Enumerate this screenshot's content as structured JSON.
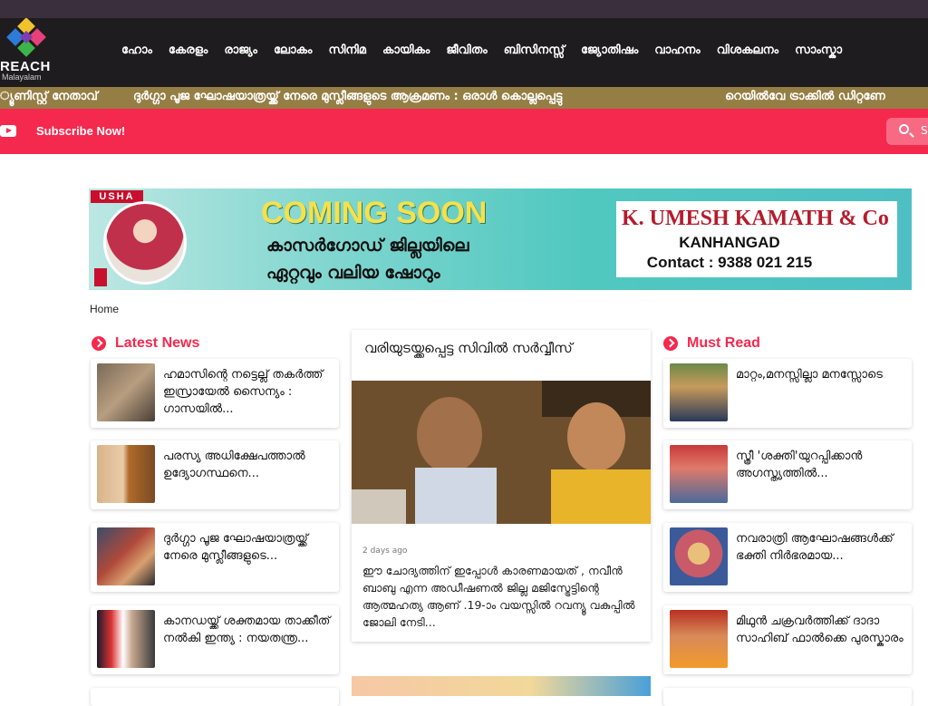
{
  "header": {
    "brand": "REACH",
    "brand_sub": "Malayalam",
    "nav": [
      "ഹോം",
      "കേരളം",
      "രാജ്യം",
      "ലോകം",
      "സിനിമ",
      "കായികം",
      "ജീവിതം",
      "ബിസിനസ്സ്",
      "ജ്യോതിഷം",
      "വാഹനം",
      "വിശകലനം",
      "സാംസ്കാ"
    ]
  },
  "ticker": [
    "്യൂണിസ്റ്റ് നേതാവ്",
    "ദുർഗ്ഗാ പൂജ ഘോഷയാത്രയ്ക്ക് നേരെ മുസ്ലീങ്ങളുടെ ആക്രമണം : ഒരാൾ കൊല്ലപ്പെട്ടു",
    "റെയിൽവേ ട്രാക്കിൽ ഡിറ്റണേ"
  ],
  "subscribe": {
    "label": "Subscribe Now!",
    "search_placeholder": "S"
  },
  "ad": {
    "brand": "USHA",
    "headline": "COMING SOON",
    "line1": "കാസർഗോഡ് ജില്ലയിലെ",
    "line2": "ഏറ്റവും വലിയ ഷോറും",
    "company": "K. UMESH KAMATH & Co",
    "place": "KANHANGAD",
    "contact": "Contact : 9388 021 215"
  },
  "breadcrumb": "Home",
  "latest": {
    "title": "Latest News",
    "items": [
      {
        "text": "ഹമാസിന്റെ നട്ടെല്ല് തകർത്ത് ഇസ്രായേൽ സൈന്യം : ഗാസയിൽ..."
      },
      {
        "text": "പരസ്യ അധിക്ഷേപത്താൽ ഉദ്യോഗസ്ഥനെ..."
      },
      {
        "text": "ദുർഗ്ഗാ പൂജ ഘോഷയാത്രയ്ക്ക് നേരെ മുസ്ലീങ്ങളുടെ..."
      },
      {
        "text": "കാനഡയ്ക്ക് ശക്തമായ താക്കീത് നൽകി ഇന്ത്യ : നയതന്ത്ര..."
      }
    ]
  },
  "featured": {
    "title": "വരിയുടയ്ക്കപ്പെട്ട സിവിൽ സർവ്വീസ്",
    "time": "2 days ago",
    "desc": "ഈ ചോദ്യത്തിന് ഇപ്പോൾ കാരണമായത് , നവീൻ ബാബു എന്ന അഡീഷണൽ ജില്ല മജിസ്ട്രേട്ടിന്റെ ആത്മഹത്യ ആണ് .19-ാം വയസ്സിൽ റവന്യൂ വകുപ്പിൽ ജോലി നേടി..."
  },
  "mustread": {
    "title": "Must Read",
    "items": [
      {
        "text": "മാറ്റം,മനസ്സില്ലാ മനസ്സോടെ"
      },
      {
        "text": "സ്ത്രീ 'ശക്തി'യുറപ്പിക്കാൻ അഗസ്ത്യത്തിൽ..."
      },
      {
        "text": "നവരാത്രി ആഘോഷങ്ങൾക്ക് ഭക്തി നിർഭരമായ..."
      },
      {
        "text": "മിഥുൻ ചക്രവർത്തിക്ക് ദാദാ സാഹിബ് ഫാൽക്കെ പുരസ്കാരം"
      }
    ]
  },
  "colors": {
    "accent": "#f5284e",
    "header_bg": "#1e1c1e",
    "ticker_bg": "#957e44"
  }
}
